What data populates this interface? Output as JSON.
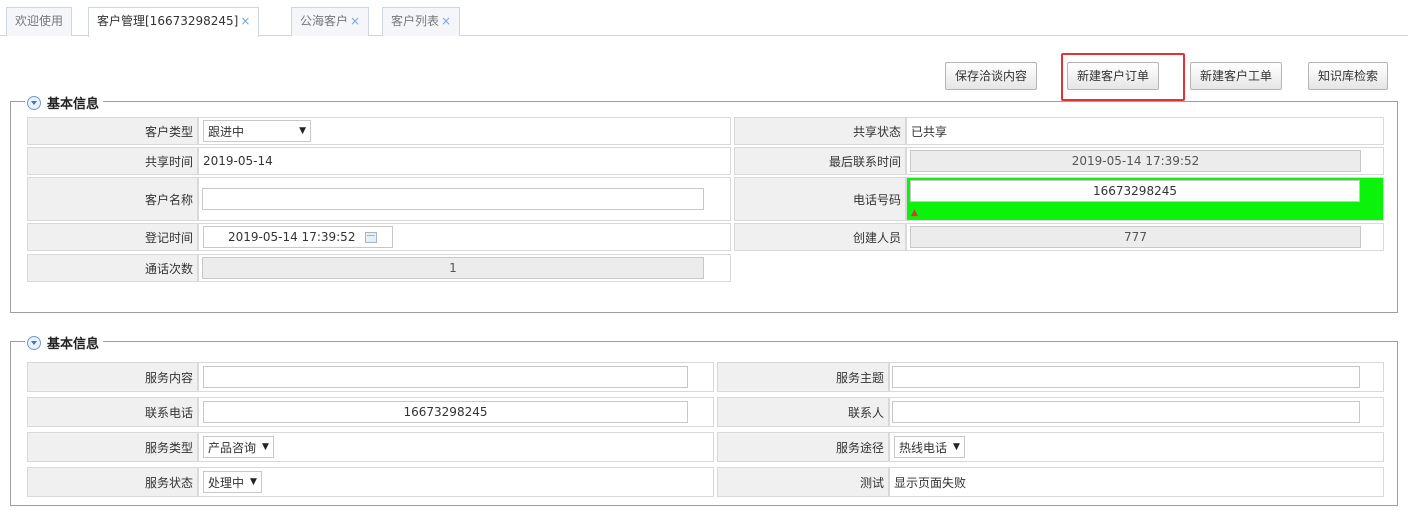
{
  "tabs": [
    {
      "label": "欢迎使用",
      "closable": false
    },
    {
      "label": "客户管理[16673298245]",
      "closable": true
    },
    {
      "label": "公海客户",
      "closable": true
    },
    {
      "label": "客户列表",
      "closable": true
    }
  ],
  "tab_close_glyph": "×",
  "toolbar": {
    "save_label": "保存洽谈内容",
    "new_order_label": "新建客户订单",
    "new_ticket_label": "新建客户工单",
    "kb_search_label": "知识库检索"
  },
  "panel1": {
    "title": "基本信息",
    "customer_type_label": "客户类型",
    "customer_type_value": "跟进中",
    "share_status_label": "共享状态",
    "share_status_value": "已共享",
    "share_time_label": "共享时间",
    "share_time_value": "2019-05-14",
    "last_contact_label": "最后联系时间",
    "last_contact_value": "2019-05-14 17:39:52",
    "customer_name_label": "客户名称",
    "customer_name_value": "",
    "phone_label": "电话号码",
    "phone_value": "16673298245",
    "phone_marker": "▲",
    "register_time_label": "登记时间",
    "register_time_value": "2019-05-14 17:39:52",
    "creator_label": "创建人员",
    "creator_value": "777",
    "call_count_label": "通话次数",
    "call_count_value": "1"
  },
  "panel2": {
    "title": "基本信息",
    "service_content_label": "服务内容",
    "service_content_value": "",
    "service_subject_label": "服务主题",
    "service_subject_value": "",
    "contact_phone_label": "联系电话",
    "contact_phone_value": "16673298245",
    "contact_person_label": "联系人",
    "contact_person_value": "",
    "service_type_label": "服务类型",
    "service_type_value": "产品咨询",
    "service_channel_label": "服务途径",
    "service_channel_value": "热线电话",
    "service_status_label": "服务状态",
    "service_status_value": "处理中",
    "test_label": "测试",
    "test_value": "显示页面失败"
  },
  "colors": {
    "highlight": "#e03434",
    "phone_field_bg": "#0bf20b",
    "legend_icon": "#3d78c4"
  },
  "icons": {
    "legend": "collapse-chevron-icon",
    "date": "calendar-icon",
    "dropdown": "caret-down-icon"
  }
}
